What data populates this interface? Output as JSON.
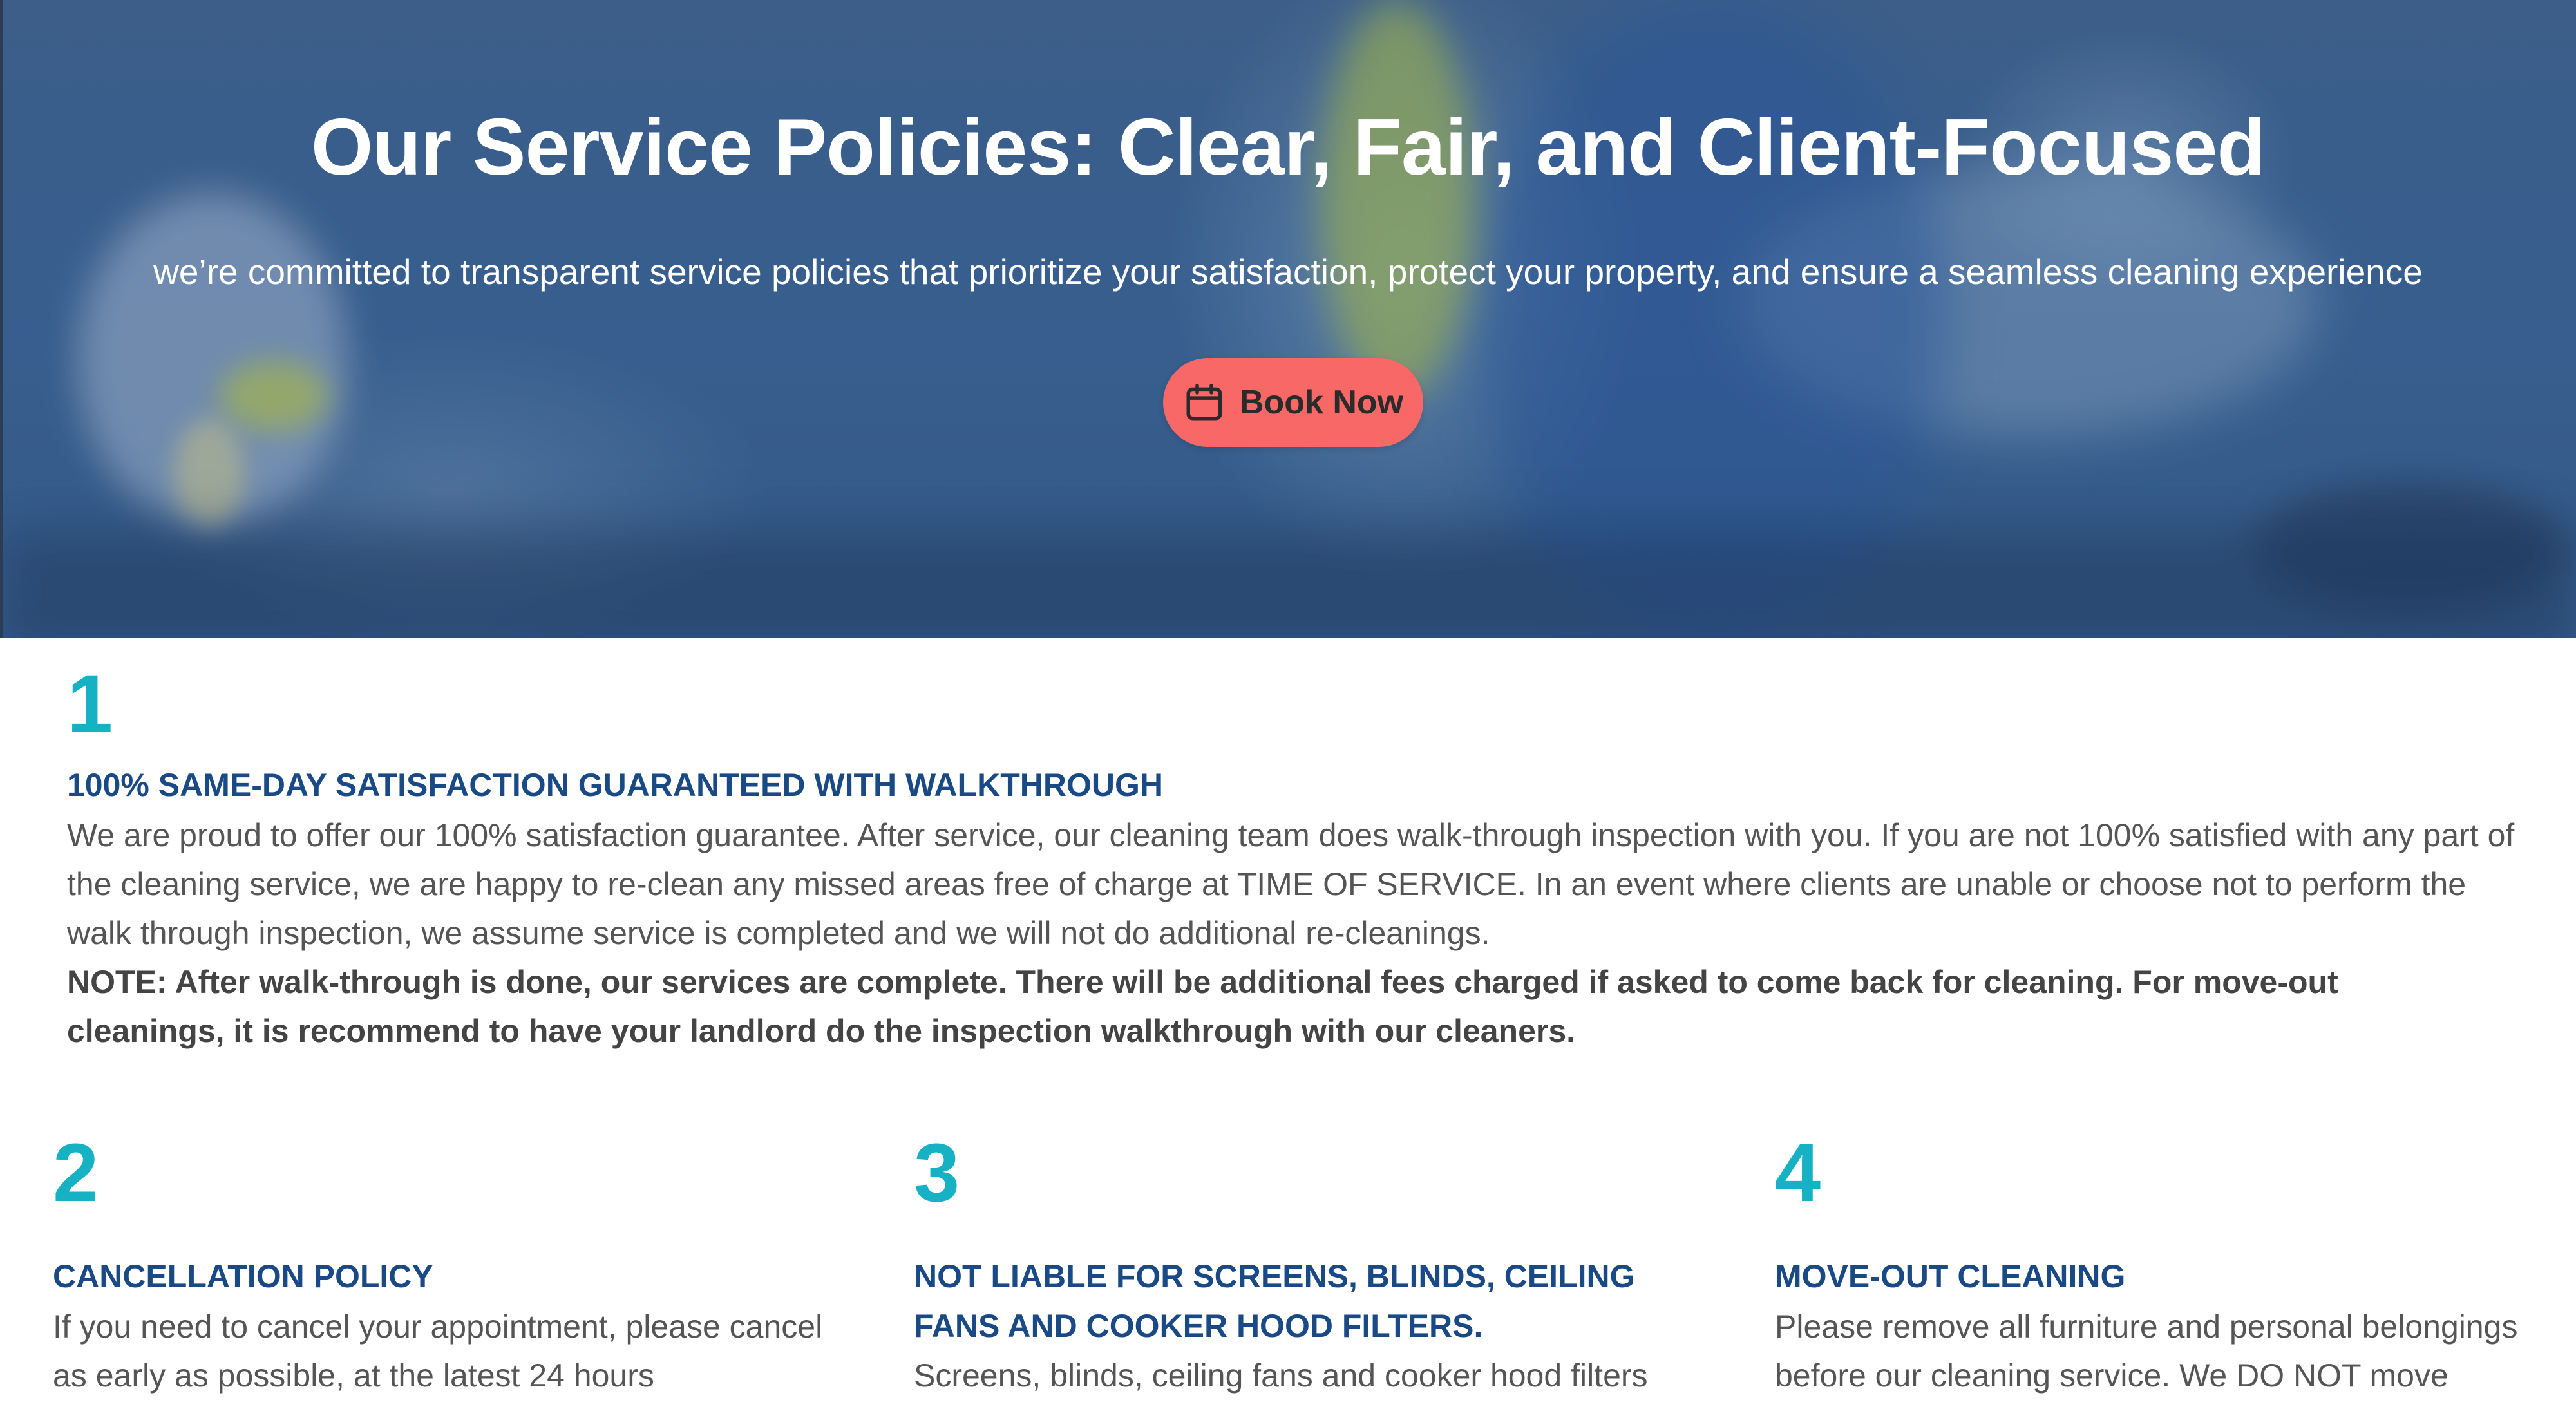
{
  "hero": {
    "title": "Our Service Policies: Clear, Fair, and Client-Focused",
    "subtitle": "we’re committed to transparent service policies that prioritize your satisfaction, protect your property, and ensure a seamless cleaning experience",
    "book_button_label": "Book Now",
    "book_button_icon": "calendar-icon",
    "accent_color": "#f86866"
  },
  "colors": {
    "number": "#16b2c3",
    "heading": "#1a4a86",
    "body_text": "#555555"
  },
  "policies": [
    {
      "number": "1",
      "title": "100% SAME-DAY SATISFACTION GUARANTEED WITH WALKTHROUGH",
      "body": "We are proud to offer our 100% satisfaction guarantee. After service, our cleaning team does walk-through inspection with you. If you are not 100% satisfied with any part of the cleaning service, we are happy to re-clean any missed areas free of charge at TIME OF SERVICE. In an event where clients are unable or choose not to perform the walk through inspection, we assume service is completed and we will not do additional re-cleanings.",
      "note": "NOTE: After walk-through is done, our services are complete. There will be additional fees charged if asked to come back for cleaning. For move-out cleanings, it is recommend to have your landlord do the inspection walkthrough with our cleaners."
    },
    {
      "number": "2",
      "title": "CANCELLATION POLICY",
      "body": "If you need to cancel your appointment, please cancel as early as possible, at the latest 24 hours"
    },
    {
      "number": "3",
      "title": "NOT LIABLE FOR SCREENS, BLINDS, CEILING FANS AND COOKER HOOD FILTERS.",
      "body": "Screens, blinds, ceiling fans and cooker hood filters"
    },
    {
      "number": "4",
      "title": "MOVE-OUT CLEANING",
      "body": "Please remove all furniture and personal belongings before our cleaning service. We DO NOT move"
    }
  ]
}
